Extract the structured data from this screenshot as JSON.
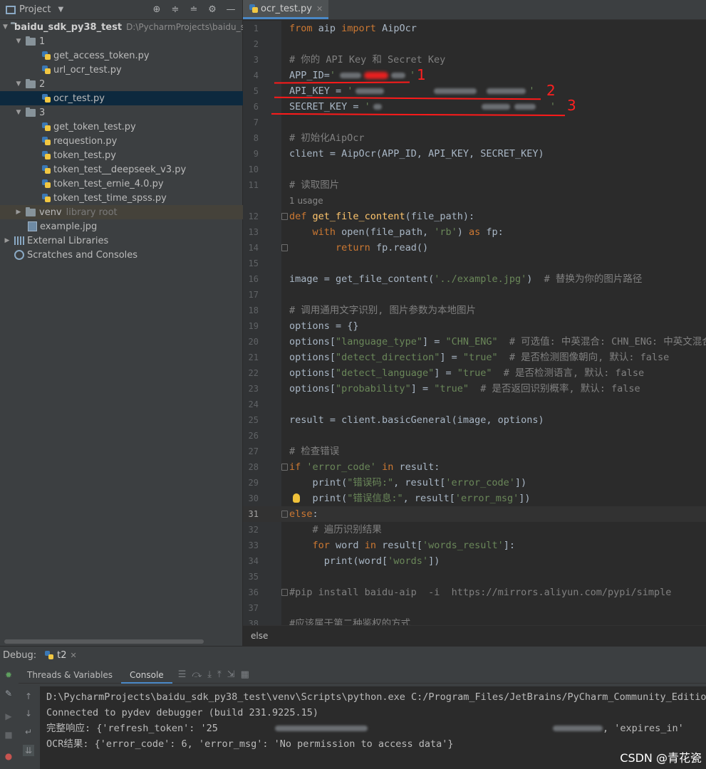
{
  "project_panel": {
    "title": "Project",
    "tree": {
      "root_name": "baidu_sdk_py38_test",
      "root_path": "D:\\PycharmProjects\\baidu_sdk",
      "folder1": "1",
      "f_get_access_token": "get_access_token.py",
      "f_url_ocr_test": "url_ocr_test.py",
      "folder2": "2",
      "f_ocr_test": "ocr_test.py",
      "folder3": "3",
      "f_get_token_test": "get_token_test.py",
      "f_requestion": "requestion.py",
      "f_token_test": "token_test.py",
      "f_token_deepseek": "token_test__deepseek_v3.py",
      "f_token_ernie": "token_test_ernie_4.0.py",
      "f_token_spss": "token_test_time_spss.py",
      "venv": "venv",
      "venv_note": "library root",
      "example_jpg": "example.jpg",
      "external_libraries": "External Libraries",
      "scratches": "Scratches and Consoles"
    }
  },
  "editor": {
    "tab_label": "ocr_test.py",
    "usage_hint": "1 usage",
    "breadcrumb": "else",
    "current_line": 31,
    "code": {
      "l1a": "from",
      "l1b": " aip ",
      "l1c": "import",
      "l1d": " AipOcr",
      "l3": "# 你的 API Key 和 Secret Key",
      "l4a": "APP_ID=",
      "l4b": "'",
      "l4c": "'",
      "l5a": "API_KEY = ",
      "l5b": "'",
      "l5c": "'",
      "l6a": "SECRET_KEY = ",
      "l6b": "'",
      "l6c": "'",
      "l8": "# 初始化AipOcr",
      "l9": "client = AipOcr(APP_ID, API_KEY, SECRET_KEY)",
      "l11": "# 读取图片",
      "l12a": "def",
      "l12b": " ",
      "l12c": "get_file_content",
      "l12d": "(file_path):",
      "l13a": "    ",
      "l13b": "with",
      "l13c": " open(file_path, ",
      "l13d": "'rb'",
      "l13e": ") ",
      "l13f": "as",
      "l13g": " fp:",
      "l14a": "        ",
      "l14b": "return",
      "l14c": " fp.read()",
      "l16a": "image = get_file_content(",
      "l16b": "'../example.jpg'",
      "l16c": ")  ",
      "l16d": "# 替换为你的图片路径",
      "l18": "# 调用通用文字识别, 图片参数为本地图片",
      "l19": "options = {}",
      "l20a": "options[",
      "l20b": "\"language_type\"",
      "l20c": "] = ",
      "l20d": "\"CHN_ENG\"",
      "l20e": "  # 可选值: 中英混合: CHN_ENG: 中英文混合;",
      "l21a": "options[",
      "l21b": "\"detect_direction\"",
      "l21c": "] = ",
      "l21d": "\"true\"",
      "l21e": "  # 是否检测图像朝向, 默认: false",
      "l22a": "options[",
      "l22b": "\"detect_language\"",
      "l22c": "] = ",
      "l22d": "\"true\"",
      "l22e": "  # 是否检测语言, 默认: false",
      "l23a": "options[",
      "l23b": "\"probability\"",
      "l23c": "] = ",
      "l23d": "\"true\"",
      "l23e": "  # 是否返回识别概率, 默认: false",
      "l25": "result = client.basicGeneral(image, options)",
      "l27": "# 检查错误",
      "l28a": "if",
      "l28b": " ",
      "l28c": "'error_code'",
      "l28d": " ",
      "l28e": "in",
      "l28f": " result:",
      "l29a": "    print(",
      "l29b": "\"错误码:\"",
      "l29c": ", result[",
      "l29d": "'error_code'",
      "l29e": "])",
      "l30a": "    print(",
      "l30b": "\"错误信息:\"",
      "l30c": ", result[",
      "l30d": "'error_msg'",
      "l30e": "])",
      "l31a": "else",
      "l31b": ":",
      "l32": "    # 遍历识别结果",
      "l33a": "    ",
      "l33b": "for",
      "l33c": " word ",
      "l33d": "in",
      "l33e": " result[",
      "l33f": "'words_result'",
      "l33g": "]:",
      "l34a": "      print(word[",
      "l34b": "'words'",
      "l34c": "])",
      "l36": "#pip install baidu-aip  -i  https://mirrors.aliyun.com/pypi/simple",
      "l38": "#应该属于第二种鉴权的方式"
    },
    "annotations": [
      "1",
      "2",
      "3"
    ]
  },
  "debug": {
    "label": "Debug:",
    "run_tab": "t2",
    "subtab_threads": "Threads & Variables",
    "subtab_console": "Console",
    "console": {
      "line1": "D:\\PycharmProjects\\baidu_sdk_py38_test\\venv\\Scripts\\python.exe C:/Program_Files/JetBrains/PyCharm_Community_Edition_",
      "line2": "Connected to pydev debugger (build 231.9225.15)",
      "line3a": "完整响应: {'refresh_token': '25",
      "line3b": ", 'expires_in'",
      "line4": "OCR结果: {'error_code': 6, 'error_msg': 'No permission to access data'}"
    },
    "watermark": "CSDN @青花瓷"
  },
  "colors": {
    "keyword": "#cc7832",
    "string": "#6a8759",
    "comment": "#808080",
    "function": "#ffc66d",
    "annotation_red": "#ff2020"
  }
}
